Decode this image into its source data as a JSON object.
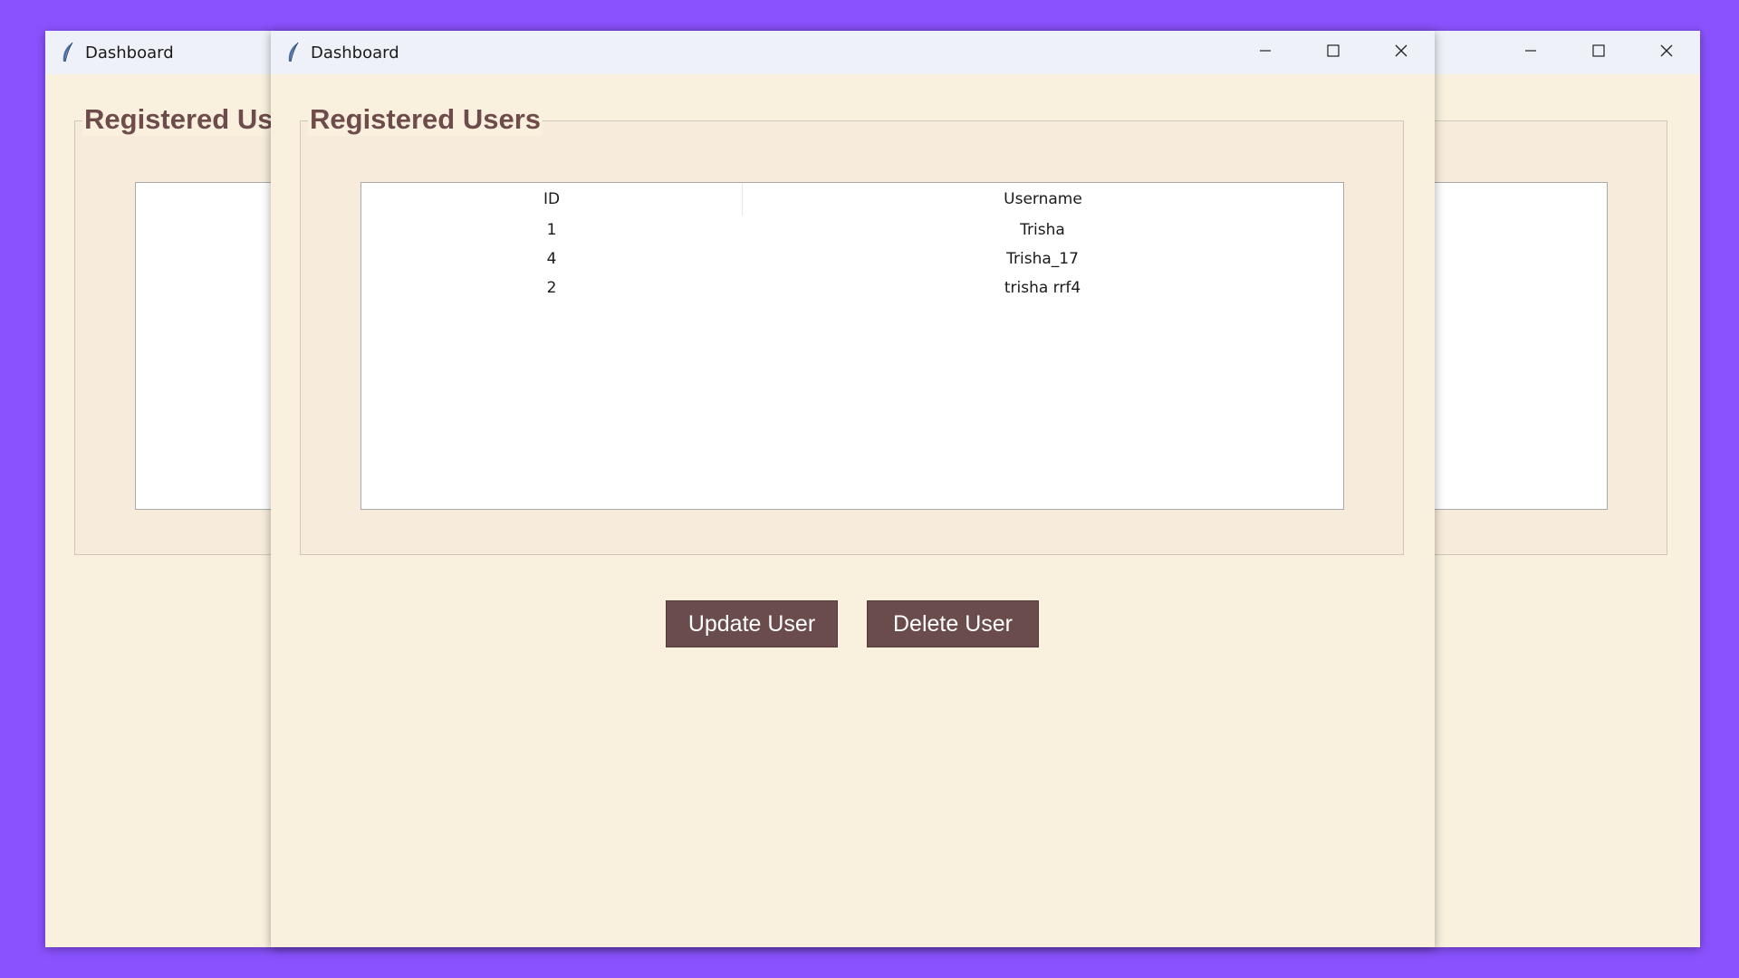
{
  "windows": {
    "back": {
      "title": "Dashboard",
      "frame_label": "Registered Users"
    },
    "front": {
      "title": "Dashboard",
      "frame_label": "Registered Users",
      "table": {
        "columns": [
          "ID",
          "Username"
        ],
        "rows": [
          {
            "id": "1",
            "username": "Trisha"
          },
          {
            "id": "4",
            "username": "Trisha_17"
          },
          {
            "id": "2",
            "username": "trisha rrf4"
          }
        ]
      },
      "buttons": {
        "update": "Update User",
        "delete": "Delete User"
      }
    }
  },
  "icons": {
    "app": "feather-icon",
    "minimize": "minimize-icon",
    "maximize": "maximize-icon",
    "close": "close-icon"
  },
  "colors": {
    "desktop": "#8a52fe",
    "window_bg": "#f9f1de",
    "frame_bg": "#f7ecdc",
    "accent": "#6b4c4c",
    "legend_text": "#6e4c4c",
    "titlebar": "#eef1f8"
  }
}
